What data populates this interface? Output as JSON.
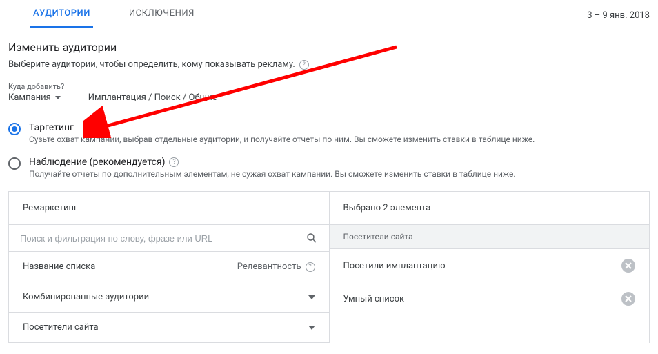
{
  "tabs": {
    "audiences": "АУДИТОРИИ",
    "exclusions": "ИСКЛЮЧЕНИЯ"
  },
  "date_range": "3 – 9 янв. 2018",
  "title": "Изменить аудитории",
  "subtitle": "Выберите аудитории, чтобы определить, кому показывать рекламу.",
  "where": {
    "label": "Куда добавить?",
    "level": "Кампания",
    "breadcrumb": "Имплантация / Поиск / Общие"
  },
  "options": {
    "targeting": {
      "label": "Таргетинг",
      "desc": "Сузьте охват кампании, выбрав отдельные аудитории, и получайте отчеты по ним. Вы сможете изменить ставки в таблице ниже."
    },
    "observation": {
      "label": "Наблюдение (рекомендуется)",
      "desc": "Получайте отчеты по дополнительным элементам, не сужая охват кампании. Вы сможете изменить ставки в таблице ниже."
    }
  },
  "left": {
    "header": "Ремаркетинг",
    "search_placeholder": "Поиск и фильтрация по слову, фразе или URL",
    "col_name": "Название списка",
    "col_relevance": "Релевантность",
    "rows": [
      "Комбинированные аудитории",
      "Посетители сайта"
    ]
  },
  "right": {
    "header": "Выбрано 2 элемента",
    "section": "Посетители сайта",
    "items": [
      "Посетили имплантацию",
      "Умный список"
    ]
  }
}
